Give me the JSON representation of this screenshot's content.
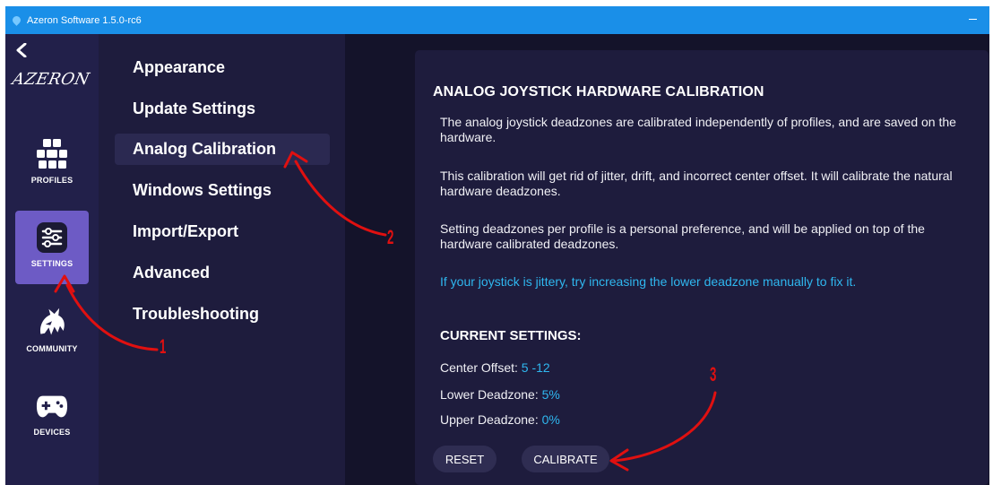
{
  "titlebar": {
    "title": "Azeron Software 1.5.0-rc6"
  },
  "nav": {
    "logo": "AZERON",
    "items": [
      {
        "label": "PROFILES",
        "icon": "grid-icon",
        "active": false
      },
      {
        "label": "SETTINGS",
        "icon": "sliders-icon",
        "active": true
      },
      {
        "label": "COMMUNITY",
        "icon": "dragon-icon",
        "active": false
      },
      {
        "label": "DEVICES",
        "icon": "gamepad-icon",
        "active": false
      }
    ]
  },
  "submenu": {
    "items": [
      {
        "label": "Appearance",
        "active": false
      },
      {
        "label": "Update Settings",
        "active": false
      },
      {
        "label": "Analog Calibration",
        "active": true
      },
      {
        "label": "Windows Settings",
        "active": false
      },
      {
        "label": "Import/Export",
        "active": false
      },
      {
        "label": "Advanced",
        "active": false
      },
      {
        "label": "Troubleshooting",
        "active": false
      }
    ]
  },
  "panel": {
    "title": "ANALOG JOYSTICK HARDWARE CALIBRATION",
    "paragraphs": [
      "The analog joystick deadzones are calibrated independently of profiles, and are saved on the hardware.",
      "This calibration will get rid of jitter, drift, and incorrect center offset. It will calibrate the natural hardware deadzones.",
      "Setting deadzones per profile is a personal preference, and will be applied on top of the hardware calibrated deadzones."
    ],
    "tip": "If your joystick is jittery, try increasing the lower deadzone manually to fix it.",
    "current_settings": {
      "title": "CURRENT SETTINGS:",
      "center_offset_label": "Center Offset:",
      "center_offset_value": "5 -12",
      "lower_deadzone_label": "Lower Deadzone:",
      "lower_deadzone_value": "5%",
      "upper_deadzone_label": "Upper Deadzone:",
      "upper_deadzone_value": "0%"
    },
    "buttons": {
      "reset": "RESET",
      "calibrate": "CALIBRATE"
    }
  },
  "annotations": {
    "one": "1",
    "two": "2",
    "three": "3"
  },
  "colors": {
    "titlebar": "#1a8fe8",
    "nav_bg": "#22204a",
    "active_nav": "#6d5bc5",
    "accent_text": "#2fb7ef",
    "annotation": "#e01010"
  }
}
